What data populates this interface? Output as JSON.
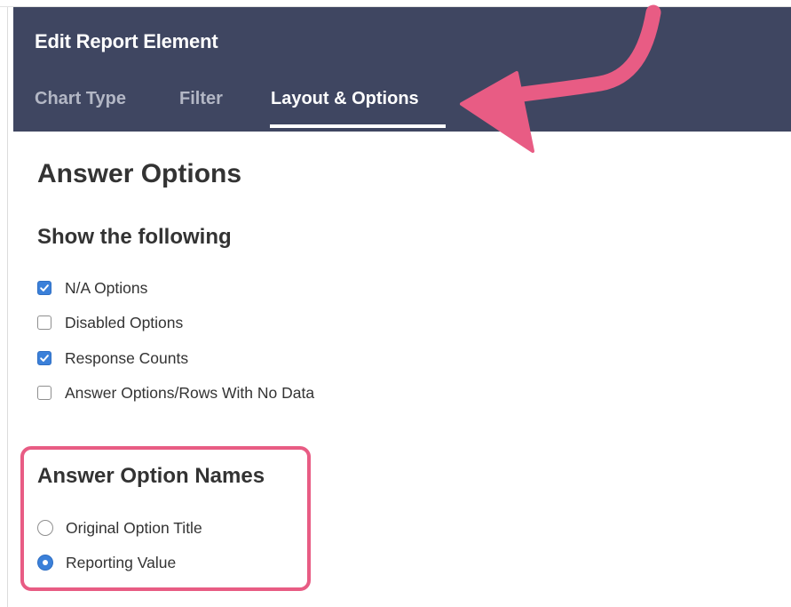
{
  "header": {
    "title": "Edit Report Element",
    "tabs": [
      {
        "label": "Chart Type",
        "active": false
      },
      {
        "label": "Filter",
        "active": false
      },
      {
        "label": "Layout & Options",
        "active": true
      }
    ]
  },
  "main": {
    "section_title": "Answer Options",
    "show_following": {
      "title": "Show the following",
      "options": [
        {
          "label": "N/A Options",
          "checked": true
        },
        {
          "label": "Disabled Options",
          "checked": false
        },
        {
          "label": "Response Counts",
          "checked": true
        },
        {
          "label": "Answer Options/Rows With No Data",
          "checked": false
        }
      ]
    },
    "answer_option_names": {
      "title": "Answer Option Names",
      "options": [
        {
          "label": "Original Option Title",
          "selected": false
        },
        {
          "label": "Reporting Value",
          "selected": true
        }
      ]
    }
  },
  "colors": {
    "header_bg": "#3f4661",
    "accent_blue": "#3b80d9",
    "annotation_pink": "#e85c84"
  }
}
